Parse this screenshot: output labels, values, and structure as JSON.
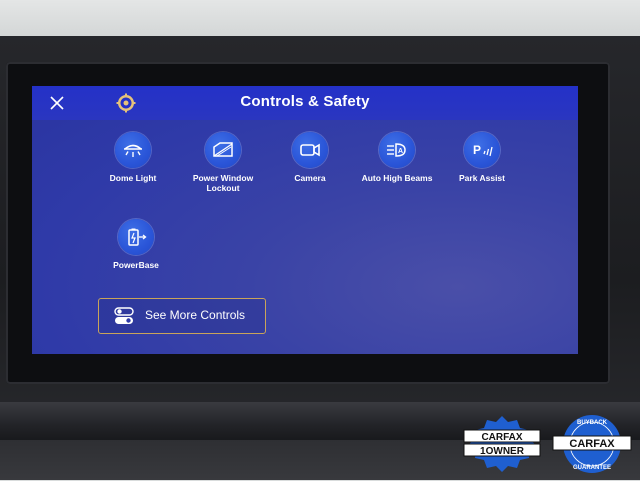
{
  "header": {
    "title": "Controls & Safety"
  },
  "tiles": [
    {
      "label": "Dome Light",
      "icon": "dome-light-icon"
    },
    {
      "label": "Power Window\nLockout",
      "icon": "window-lockout-icon"
    },
    {
      "label": "Camera",
      "icon": "camera-icon"
    },
    {
      "label": "Auto High Beams",
      "icon": "high-beam-icon"
    },
    {
      "label": "Park Assist",
      "icon": "park-assist-icon"
    },
    {
      "label": "PowerBase",
      "icon": "powerbase-icon"
    }
  ],
  "more_button": {
    "label": "See More Controls"
  },
  "badges": {
    "owner": {
      "brand": "CARFAX",
      "text": "1OWNER"
    },
    "buyback": {
      "brand": "CARFAX",
      "ring_top": "BUYBACK",
      "ring_bottom": "GUARANTEE"
    }
  },
  "colors": {
    "screen_bg": "#2f3aa8",
    "titlebar": "#2431c8",
    "tile_circle": "#2a55d8",
    "button_border": "#c9a45a"
  }
}
